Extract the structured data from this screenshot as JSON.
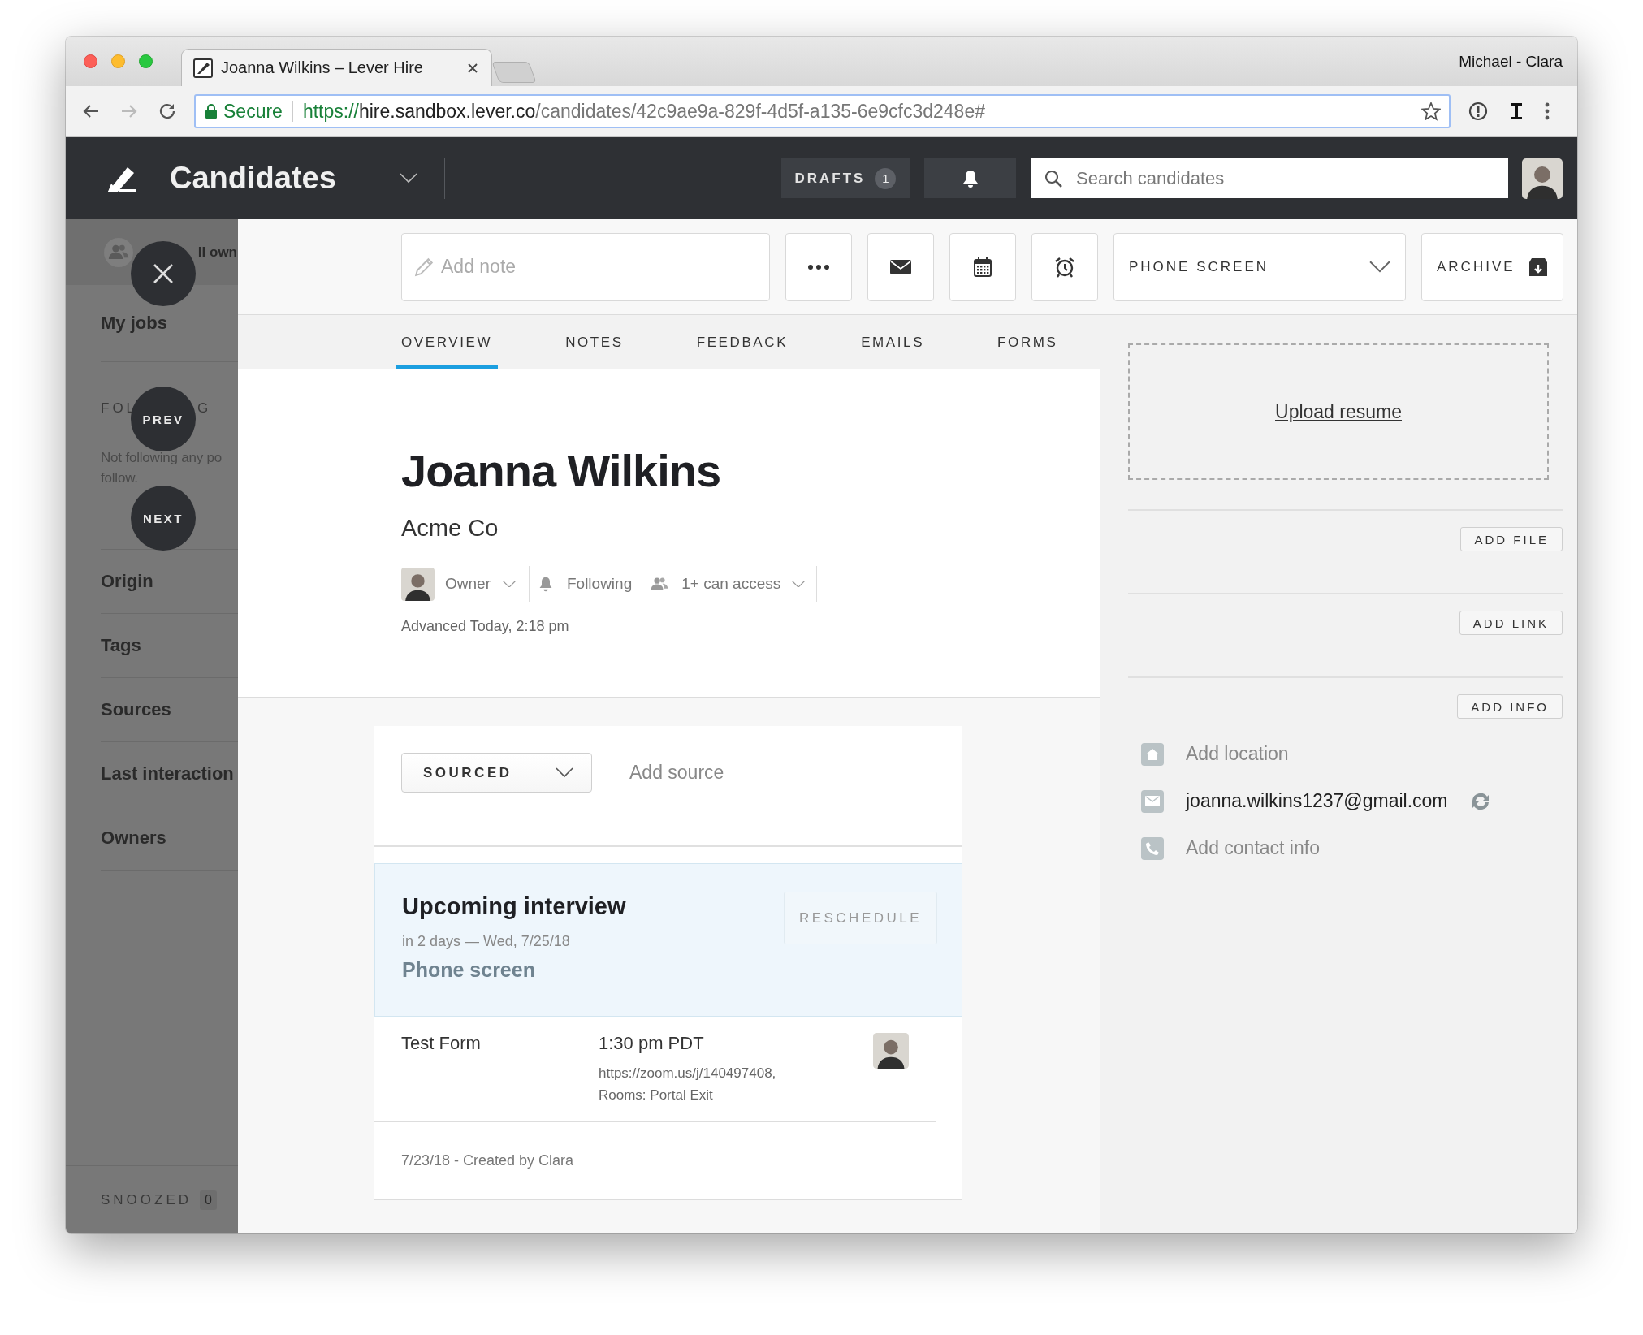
{
  "browser": {
    "tabs": [
      {
        "title": "Joanna Wilkins –  Lever Hire",
        "selected": true
      }
    ],
    "profile": "Michael - Clara",
    "address": {
      "secure_label": "Secure",
      "scheme": "https://",
      "host": "hire.sandbox.lever.co",
      "path": "/candidates/42c9ae9a-829f-4d5f-a135-6e9cfc3d248e#"
    }
  },
  "nav": {
    "title": "Candidates",
    "drafts": {
      "label": "DRAFTS",
      "count": "1"
    },
    "search": {
      "placeholder": "Search candidates"
    }
  },
  "sidebar": {
    "top_label": "ll own",
    "items": [
      {
        "kind": "link",
        "label": "My jobs"
      },
      {
        "kind": "section",
        "parts": [
          "FOL",
          "G"
        ],
        "lines": [
          "Not following any po",
          "follow."
        ]
      },
      {
        "kind": "link",
        "label": "Origin"
      },
      {
        "kind": "link",
        "label": "Tags"
      },
      {
        "kind": "link",
        "label": "Sources"
      },
      {
        "kind": "link",
        "label": "Last interaction"
      },
      {
        "kind": "link",
        "label": "Owners"
      }
    ],
    "footer": {
      "label": "SNOOZED",
      "count": "0"
    }
  },
  "overlay_controls": [
    {
      "kind": "close"
    },
    {
      "kind": "prev",
      "label": "PREV"
    },
    {
      "kind": "next",
      "label": "NEXT"
    }
  ],
  "toolbar": {
    "note": {
      "placeholder": "Add note"
    },
    "icon_buttons": [
      {
        "kind": "more"
      },
      {
        "kind": "email"
      },
      {
        "kind": "calendar"
      },
      {
        "kind": "alarm"
      }
    ],
    "stage": "PHONE SCREEN",
    "archive": "ARCHIVE"
  },
  "tabs": [
    {
      "label": "OVERVIEW",
      "selected": true
    },
    {
      "label": "NOTES",
      "selected": false
    },
    {
      "label": "FEEDBACK",
      "selected": false
    },
    {
      "label": "EMAILS",
      "selected": false
    },
    {
      "label": "FORMS",
      "selected": false
    }
  ],
  "candidate": {
    "name": "Joanna Wilkins",
    "company": "Acme Co",
    "owner": "Owner",
    "following": "Following",
    "access": "1+ can access",
    "advanced": "Advanced Today, 2:18 pm"
  },
  "source": {
    "stage": "SOURCED",
    "add_source": "Add source"
  },
  "interview": {
    "heading": "Upcoming interview",
    "when": "in 2 days — Wed, 7/25/18",
    "type": "Phone screen",
    "reschedule": "RESCHEDULE",
    "form": "Test Form",
    "time": "1:30 pm PDT",
    "location_lines": [
      "https://zoom.us/j/140497408,",
      "Rooms: Portal Exit"
    ],
    "created": "7/23/18 - Created by Clara"
  },
  "side_panel": {
    "upload": "Upload resume",
    "buttons": [
      "ADD FILE",
      "ADD LINK",
      "ADD INFO"
    ],
    "contacts": [
      {
        "kind": "location",
        "text": "Add location",
        "filled": false
      },
      {
        "kind": "email",
        "text": "joanna.wilkins1237@gmail.com",
        "filled": true
      },
      {
        "kind": "phone",
        "text": "Add contact info",
        "filled": false
      }
    ]
  }
}
